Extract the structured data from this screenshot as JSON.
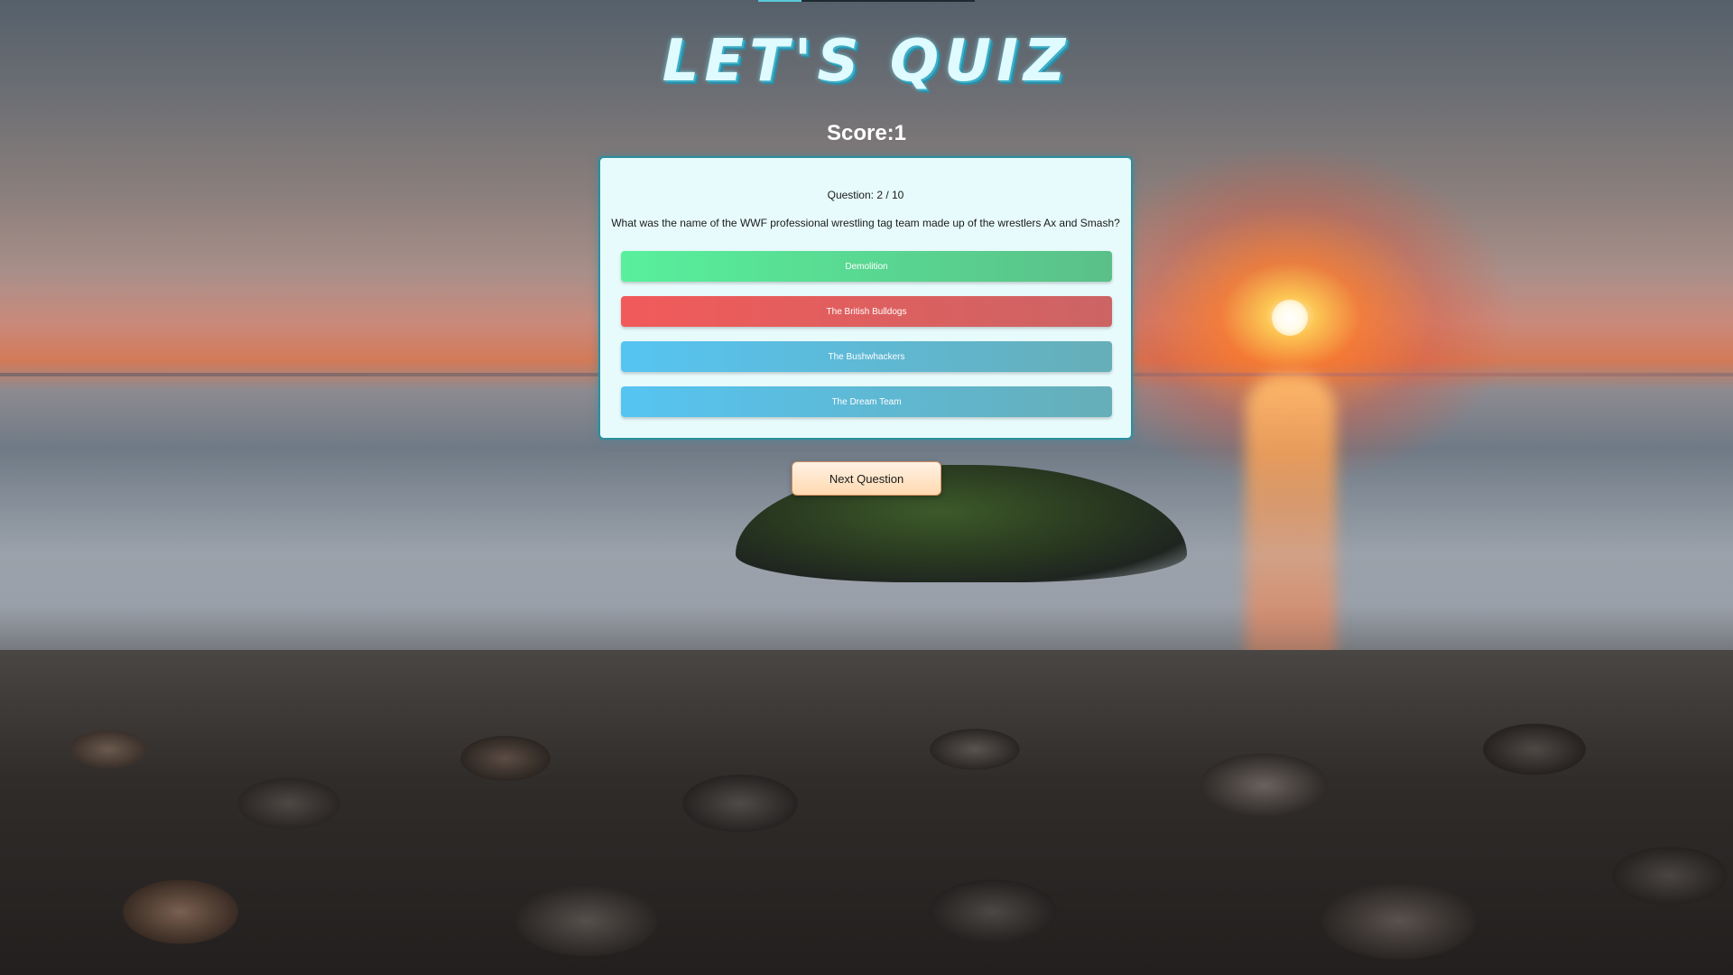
{
  "app": {
    "title": "LET'S QUIZ",
    "score_text": "Score:1",
    "progress_fraction": 0.2
  },
  "quiz": {
    "question_counter": "Question: 2 / 10",
    "question_text": "What was the name of the WWF professional wrestling tag team made up of the wrestlers Ax and Smash?",
    "answers": [
      {
        "label": "Demolition",
        "state": "correct"
      },
      {
        "label": "The British Bulldogs",
        "state": "wrong"
      },
      {
        "label": "The Bushwhackers",
        "state": "neutral"
      },
      {
        "label": "The Dream Team",
        "state": "neutral"
      }
    ]
  },
  "actions": {
    "next_label": "Next Question"
  },
  "colors": {
    "correct": "#58f09c",
    "wrong": "#f25a5a",
    "neutral": "#56c4f2",
    "card_border": "#2a8fa0",
    "title": "#dffbff"
  }
}
